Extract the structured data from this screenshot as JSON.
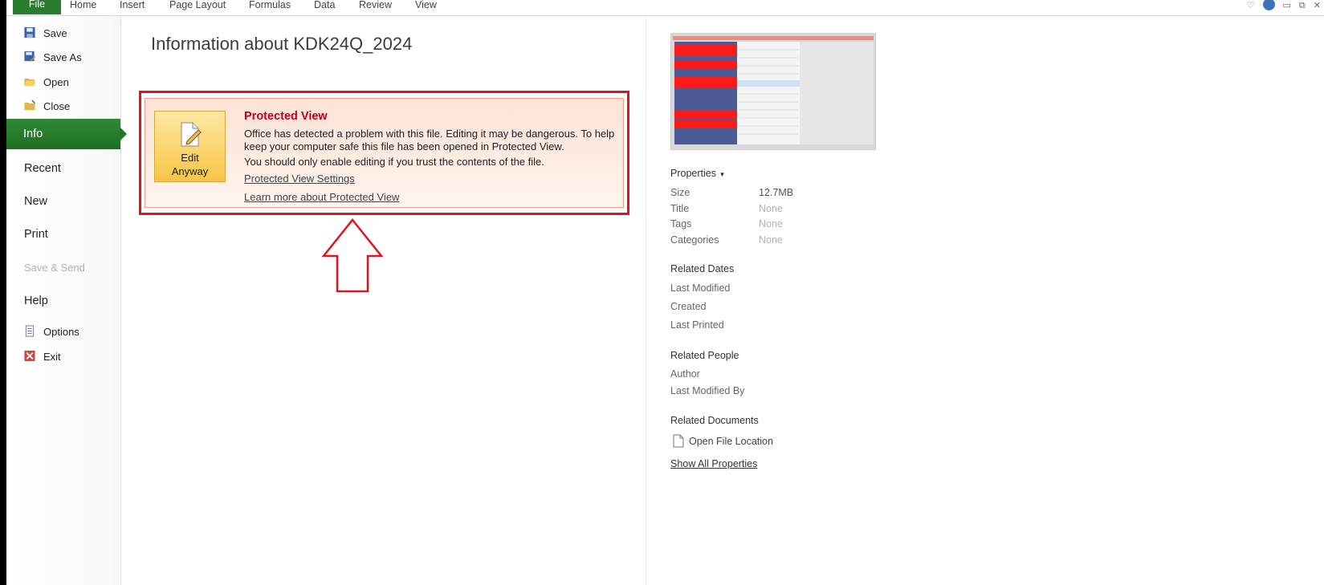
{
  "ribbon": {
    "tabs": [
      "File",
      "Home",
      "Insert",
      "Page Layout",
      "Formulas",
      "Data",
      "Review",
      "View"
    ]
  },
  "nav": {
    "save": "Save",
    "save_as": "Save As",
    "open": "Open",
    "close": "Close",
    "info": "Info",
    "recent": "Recent",
    "new": "New",
    "print": "Print",
    "save_send": "Save & Send",
    "help": "Help",
    "options": "Options",
    "exit": "Exit"
  },
  "main": {
    "title": "Information about KDK24Q_2024",
    "protected": {
      "button_line1": "Edit",
      "button_line2": "Anyway",
      "heading": "Protected View",
      "message": "Office has detected a problem with this file. Editing it may be dangerous. To help keep your computer safe this file has been opened in Protected View.",
      "advice": "You should only enable editing if you trust the contents of the file.",
      "settings_link": "Protected View Settings",
      "learn_link": "Learn more about Protected View"
    }
  },
  "properties": {
    "header": "Properties",
    "size_label": "Size",
    "size_value": "12.7MB",
    "title_label": "Title",
    "title_value": "None",
    "tags_label": "Tags",
    "tags_value": "None",
    "categories_label": "Categories",
    "categories_value": "None"
  },
  "related_dates": {
    "header": "Related Dates",
    "last_modified": "Last Modified",
    "created": "Created",
    "last_printed": "Last Printed"
  },
  "related_people": {
    "header": "Related People",
    "author": "Author",
    "last_modified_by": "Last Modified By"
  },
  "related_documents": {
    "header": "Related Documents",
    "open_location": "Open File Location",
    "show_all": "Show All Properties"
  },
  "colors": {
    "accent_green": "#2a7d2e",
    "alert_red": "#e0141f",
    "button_yellow": "#fbd36a"
  }
}
